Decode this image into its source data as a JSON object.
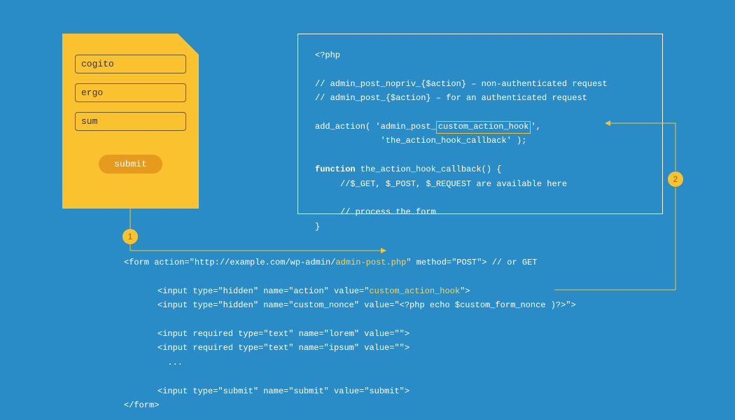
{
  "form": {
    "field1": "cogito",
    "field2": "ergo",
    "field3": "sum",
    "submit": "submit"
  },
  "php": {
    "open": "<?php",
    "c1": "// admin_post_nopriv_{$action} – non-authenticated request",
    "c2": "// admin_post_{$action} – for an authenticated request",
    "add_pre": "add_action( 'admin_post_",
    "hook": "custom_action_hook",
    "add_post": "',",
    "add_l2": "             'the_action_hook_callback' );",
    "fn_kw": "function",
    "fn_sig": " the_action_hook_callback() {",
    "fn_c1": "     //$_GET, $_POST, $_REQUEST are available here",
    "fn_c2": "     // process the form",
    "fn_close": "}"
  },
  "html": {
    "form_open_a": "<form action=\"http://example.com/wp-admin/",
    "form_open_b": "admin-post.php",
    "form_open_c": "\" method=\"POST\"> // or GET",
    "inp_action_a": "<input type=\"hidden\" name=\"action\" value=\"",
    "inp_action_b": "custom_action_hook",
    "inp_action_c": "\">",
    "inp_nonce": "<input type=\"hidden\" name=\"custom_nonce\" value=\"<?php echo $custom_form_nonce )?>\">",
    "inp_lorem": "<input required type=\"text\" name=\"lorem\" value=\"\">",
    "inp_ipsum": "<input required type=\"text\" name=\"ipsum\" value=\"\">",
    "dots": "  ...",
    "inp_submit": "<input type=\"submit\" name=\"submit\" value=\"submit\">",
    "form_close": "</form>"
  },
  "badges": {
    "one": "1",
    "two": "2"
  }
}
